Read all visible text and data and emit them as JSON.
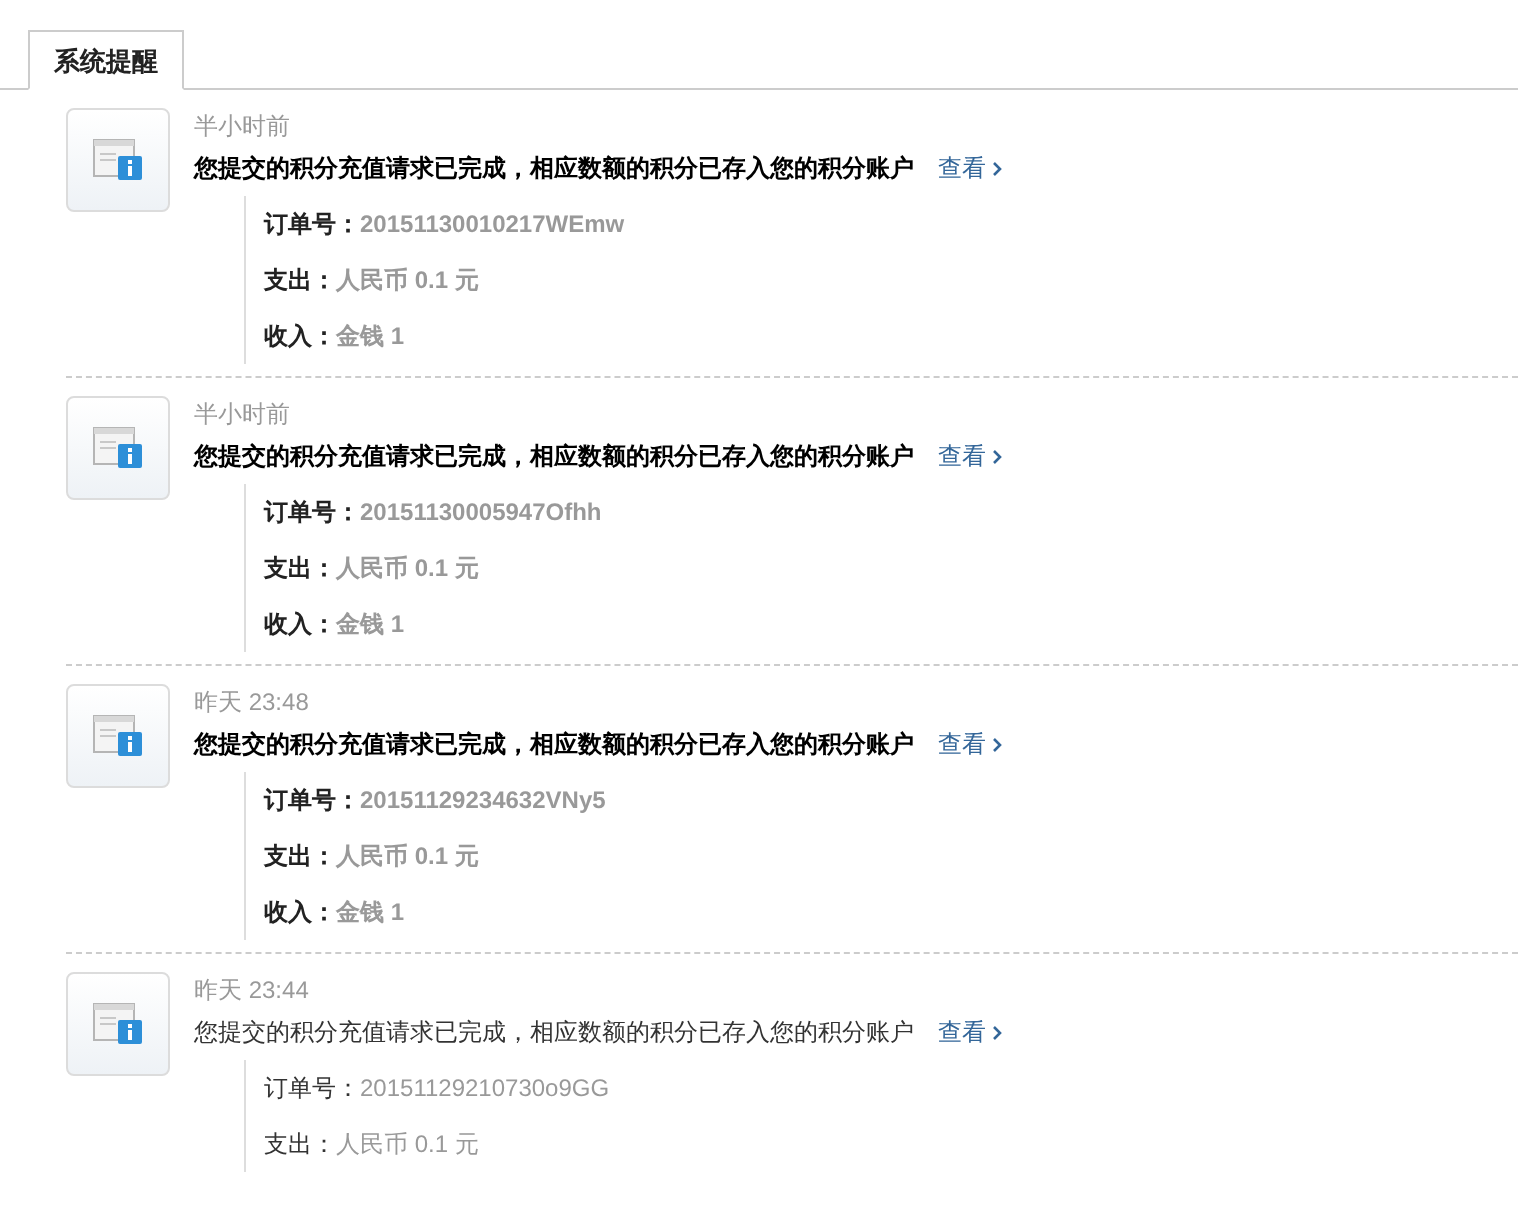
{
  "tabs": [
    {
      "label": "系统提醒",
      "selected": true
    }
  ],
  "notices": [
    {
      "time": "半小时前",
      "unread": true,
      "message": "您提交的积分充值请求已完成，相应数额的积分已存入您的积分账户",
      "link": "查看",
      "details": [
        {
          "label": "订单号：",
          "value": "20151130010217WEmw"
        },
        {
          "label": "支出：",
          "value": "人民币 0.1 元"
        },
        {
          "label": "收入：",
          "value": "金钱 1"
        }
      ]
    },
    {
      "time": "半小时前",
      "unread": true,
      "message": "您提交的积分充值请求已完成，相应数额的积分已存入您的积分账户",
      "link": "查看",
      "details": [
        {
          "label": "订单号：",
          "value": "20151130005947Ofhh"
        },
        {
          "label": "支出：",
          "value": "人民币 0.1 元"
        },
        {
          "label": "收入：",
          "value": "金钱 1"
        }
      ]
    },
    {
      "time": "昨天 23:48",
      "unread": true,
      "message": "您提交的积分充值请求已完成，相应数额的积分已存入您的积分账户",
      "link": "查看",
      "details": [
        {
          "label": "订单号：",
          "value": "20151129234632VNy5"
        },
        {
          "label": "支出：",
          "value": "人民币 0.1 元"
        },
        {
          "label": "收入：",
          "value": "金钱 1"
        }
      ]
    },
    {
      "time": "昨天 23:44",
      "unread": false,
      "message": "您提交的积分充值请求已完成，相应数额的积分已存入您的积分账户",
      "link": "查看",
      "details": [
        {
          "label": "订单号：",
          "value": "20151129210730o9GG"
        },
        {
          "label": "支出：",
          "value": "人民币 0.1 元"
        }
      ]
    }
  ]
}
